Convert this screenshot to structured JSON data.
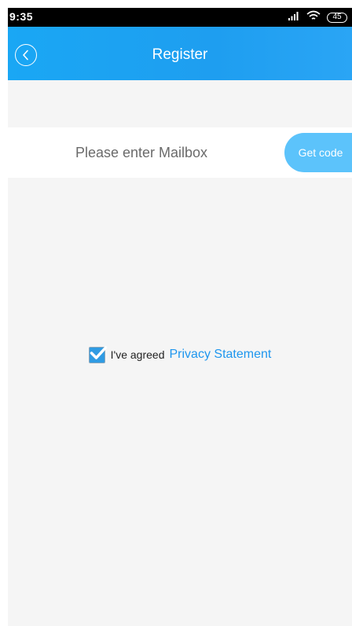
{
  "status_bar": {
    "time": "9:35",
    "battery": "45"
  },
  "header": {
    "title": "Register"
  },
  "form": {
    "mailbox_placeholder": "Please enter Mailbox",
    "get_code_label": "Get code"
  },
  "agreement": {
    "checked": true,
    "text": "I've agreed",
    "link_label": "Privacy Statement"
  },
  "colors": {
    "header_blue": "#1e9ef0",
    "get_code_button": "#5cc3fb",
    "link_blue": "#1e96ee",
    "background": "#f5f5f5"
  },
  "icons": {
    "back": "back-arrow-circle-icon",
    "signal": "signal-icon",
    "wifi": "wifi-icon",
    "battery": "battery-icon",
    "check": "checkmark-icon"
  }
}
